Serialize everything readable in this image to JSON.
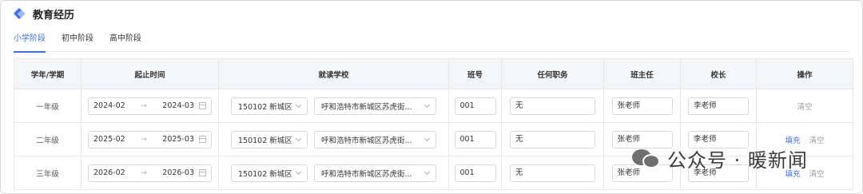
{
  "header": {
    "title": "教育经历"
  },
  "tabs": [
    {
      "label": "小学阶段",
      "active": true
    },
    {
      "label": "初中阶段",
      "active": false
    },
    {
      "label": "高中阶段",
      "active": false
    }
  ],
  "table": {
    "columns": [
      "学年/学期",
      "起止时间",
      "就读学校",
      "班号",
      "任何职务",
      "班主任",
      "校长",
      "操作"
    ],
    "rows": [
      {
        "grade": "一年级",
        "start": "2024-02",
        "end": "2024-03",
        "district": "150102 新城区",
        "school": "呼和浩特市新城区苏虎街...",
        "class_no": "001",
        "position": "无",
        "head_teacher": "张老师",
        "principal": "李老师",
        "actions": [
          "清空"
        ]
      },
      {
        "grade": "二年级",
        "start": "2025-02",
        "end": "2025-03",
        "district": "150102 新城区",
        "school": "呼和浩特市新城区苏虎街...",
        "class_no": "001",
        "position": "无",
        "head_teacher": "张老师",
        "principal": "李老师",
        "actions": [
          "填充",
          "清空"
        ]
      },
      {
        "grade": "三年级",
        "start": "2026-02",
        "end": "2026-03",
        "district": "150102 新城区",
        "school": "呼和浩特市新城区苏虎街...",
        "class_no": "001",
        "position": "无",
        "head_teacher": "张老师",
        "principal": "李老师",
        "actions": [
          "填充",
          "清空"
        ]
      }
    ],
    "range_arrow": "→"
  },
  "watermark": {
    "text": "公众号 · 暖新闻",
    "icon": "wechat-icon"
  },
  "colors": {
    "accent": "#3b6ff5",
    "header_bg": "#f5f6f8",
    "border": "#e8e8e8"
  }
}
